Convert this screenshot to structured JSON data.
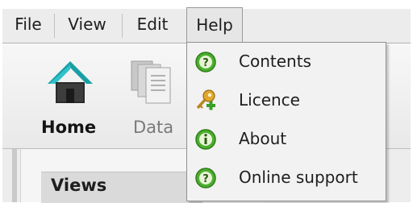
{
  "menubar": {
    "items": [
      {
        "label": "File"
      },
      {
        "label": "View"
      },
      {
        "label": "Edit"
      },
      {
        "label": "Help"
      }
    ]
  },
  "ribbon": {
    "home_label": "Home",
    "data_label": "Data"
  },
  "help_menu": {
    "items": [
      {
        "label": "Contents",
        "icon": "help-icon"
      },
      {
        "label": "Licence",
        "icon": "key-add-icon"
      },
      {
        "label": "About",
        "icon": "info-icon"
      },
      {
        "label": "Online support",
        "icon": "help-icon"
      }
    ]
  },
  "panel": {
    "views_title": "Views"
  },
  "colors": {
    "menubar_bg": "#ececec",
    "dropdown_bg": "#f2f2f2",
    "home_icon_teal": "#1a9fa5",
    "help_icon_green": "#4caf2e",
    "key_gold": "#e0a82e"
  }
}
